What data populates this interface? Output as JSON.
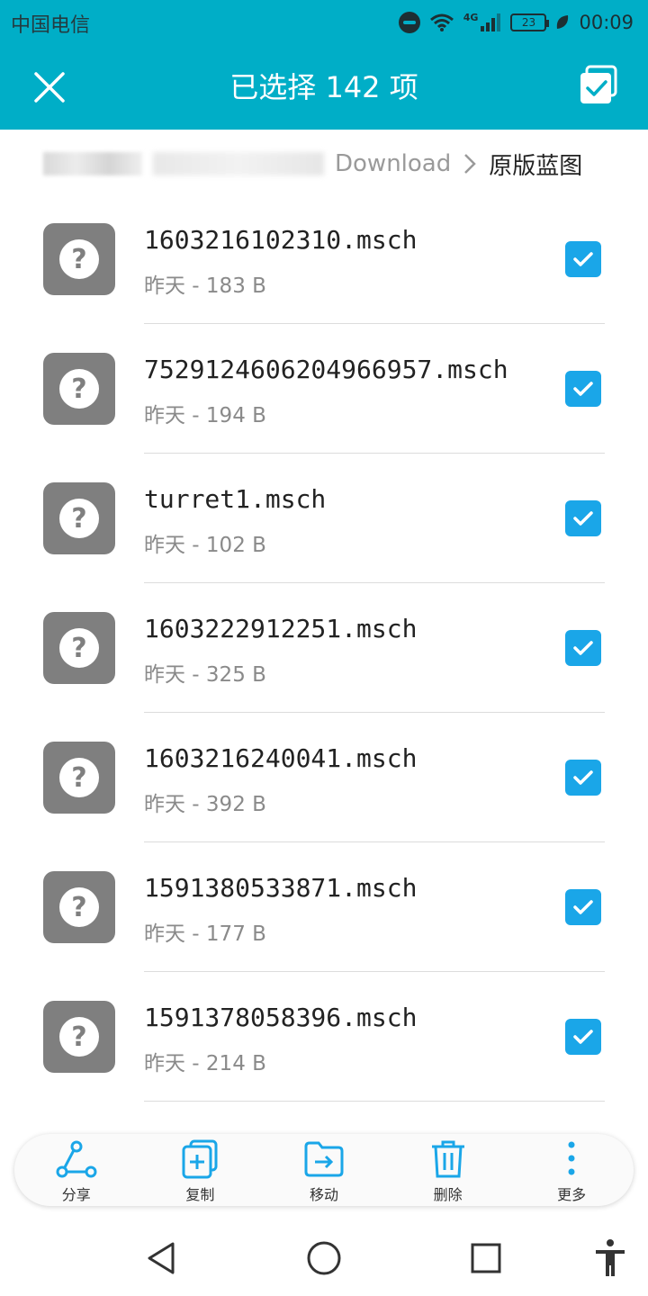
{
  "status_bar": {
    "carrier": "中国电信",
    "network": "4G",
    "battery": "23",
    "time": "00:09"
  },
  "header": {
    "title": "已选择 142 项",
    "close_icon": "close-icon",
    "select_all_icon": "select-all-icon"
  },
  "breadcrumb": {
    "segments": [
      "Download"
    ],
    "current": "原版蓝图"
  },
  "files": [
    {
      "name": "1603216102310.msch",
      "meta": "昨天 - 183 B",
      "checked": true
    },
    {
      "name": "7529124606204966957.msch",
      "meta": "昨天 - 194 B",
      "checked": true
    },
    {
      "name": "turret1.msch",
      "meta": "昨天 - 102 B",
      "checked": true
    },
    {
      "name": "1603222912251.msch",
      "meta": "昨天 - 325 B",
      "checked": true
    },
    {
      "name": "1603216240041.msch",
      "meta": "昨天 - 392 B",
      "checked": true
    },
    {
      "name": "1591380533871.msch",
      "meta": "昨天 - 177 B",
      "checked": true
    },
    {
      "name": "1591378058396.msch",
      "meta": "昨天 - 214 B",
      "checked": true
    }
  ],
  "actions": [
    {
      "label": "分享",
      "icon": "share-icon"
    },
    {
      "label": "复制",
      "icon": "copy-icon"
    },
    {
      "label": "移动",
      "icon": "move-icon"
    },
    {
      "label": "删除",
      "icon": "delete-icon"
    },
    {
      "label": "更多",
      "icon": "more-icon"
    }
  ],
  "colors": {
    "accent": "#00aec7",
    "checkbox": "#1aa6e8",
    "action_icon": "#1aa6e8"
  }
}
